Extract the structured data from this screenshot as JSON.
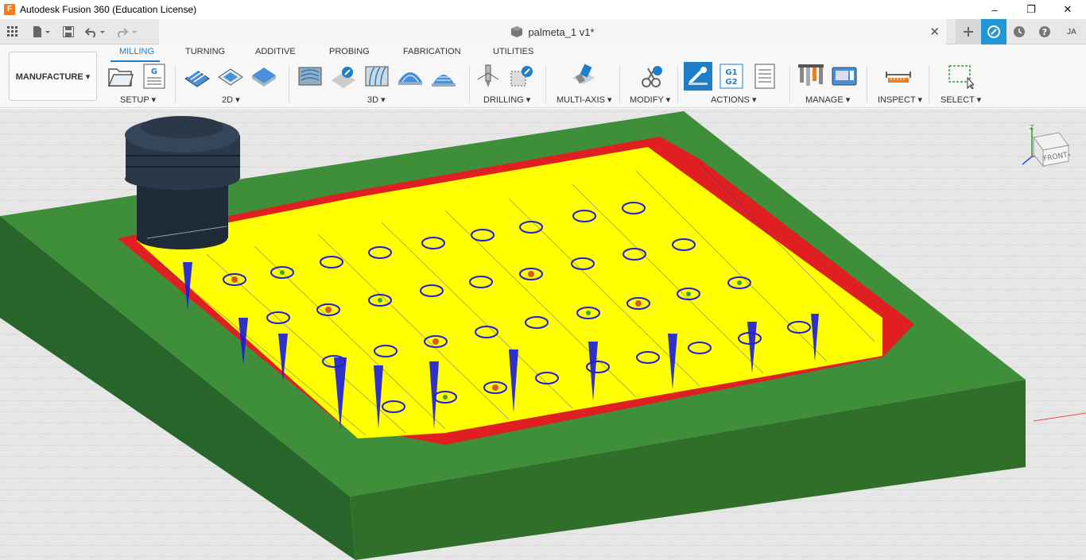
{
  "app": {
    "title": "Autodesk Fusion 360 (Education License)",
    "logo_letter": "F"
  },
  "window_controls": {
    "minimize": "–",
    "restore": "❐",
    "close": "✕"
  },
  "document": {
    "name": "palmeta_1 v1*",
    "close": "✕"
  },
  "user": {
    "initials": "JA"
  },
  "workspace": {
    "label": "MANUFACTURE ▾"
  },
  "tabs": [
    {
      "label": "MILLING",
      "active": true
    },
    {
      "label": "TURNING",
      "active": false
    },
    {
      "label": "ADDITIVE",
      "active": false
    },
    {
      "label": "PROBING",
      "active": false
    },
    {
      "label": "FABRICATION",
      "active": false
    },
    {
      "label": "UTILITIES",
      "active": false
    }
  ],
  "groups": {
    "setup": "SETUP ▾",
    "g2d": "2D ▾",
    "g3d": "3D ▾",
    "drilling": "DRILLING ▾",
    "multiaxis": "MULTI-AXIS ▾",
    "modify": "MODIFY ▾",
    "actions": "ACTIONS ▾",
    "manage": "MANAGE ▾",
    "inspect": "INSPECT ▾",
    "select": "SELECT ▾"
  },
  "actions_g_label": {
    "line1": "G1",
    "line2": "G2"
  },
  "setup_g_label": "G",
  "viewcube": {
    "front": "FRONT",
    "axis_z": "Z",
    "axis_x": "X",
    "axis_y": "Y"
  },
  "colors": {
    "accent": "#1e7ec8",
    "stock_green": "#3f8f3a",
    "toolpath_yellow": "#ffff00",
    "toolpath_red": "#e02020",
    "toolpath_blue": "#1a1ae0"
  }
}
